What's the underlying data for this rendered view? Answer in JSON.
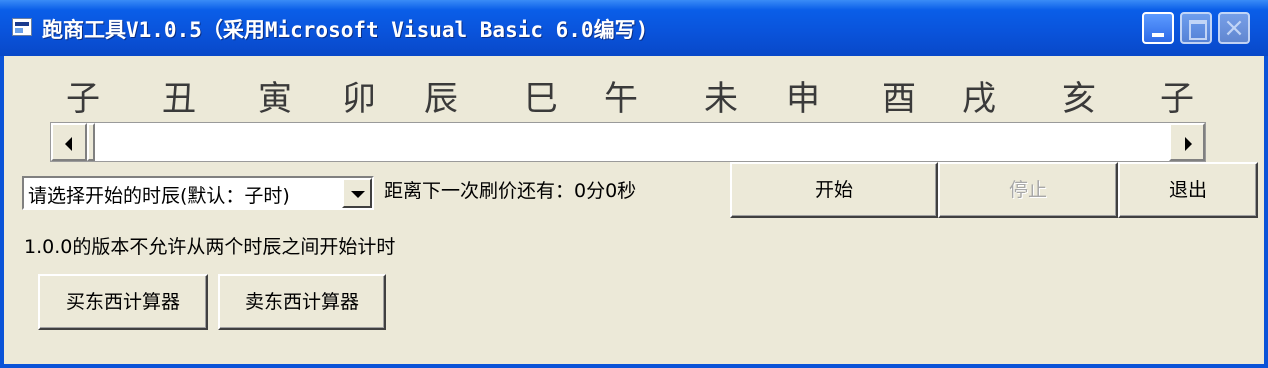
{
  "window": {
    "title": "跑商工具V1.0.5（采用Microsoft Visual Basic 6.0编写)"
  },
  "titlebar_buttons": {
    "minimize": "minimize",
    "maximize": "maximize",
    "close": "close",
    "close_glyph": "×"
  },
  "hours": [
    "子",
    "丑",
    "寅",
    "卯",
    "辰",
    "巳",
    "午",
    "未",
    "申",
    "酉",
    "戌",
    "亥",
    "子"
  ],
  "scrollbar": {
    "value": 0
  },
  "start_hour_select": {
    "selected": "请选择开始的时辰(默认：子时)"
  },
  "countdown_label": "距离下一次刷价还有：0分0秒",
  "note_label": "1.0.0的版本不允许从两个时辰之间开始计时",
  "buttons": {
    "start": "开始",
    "stop": "停止",
    "exit": "退出",
    "buy_calc": "买东西计算器",
    "sell_calc": "卖东西计算器"
  },
  "colors": {
    "titlebar": "#0a54dc",
    "window_bg": "#ece9d8",
    "disabled_text": "#a8a8a8"
  }
}
